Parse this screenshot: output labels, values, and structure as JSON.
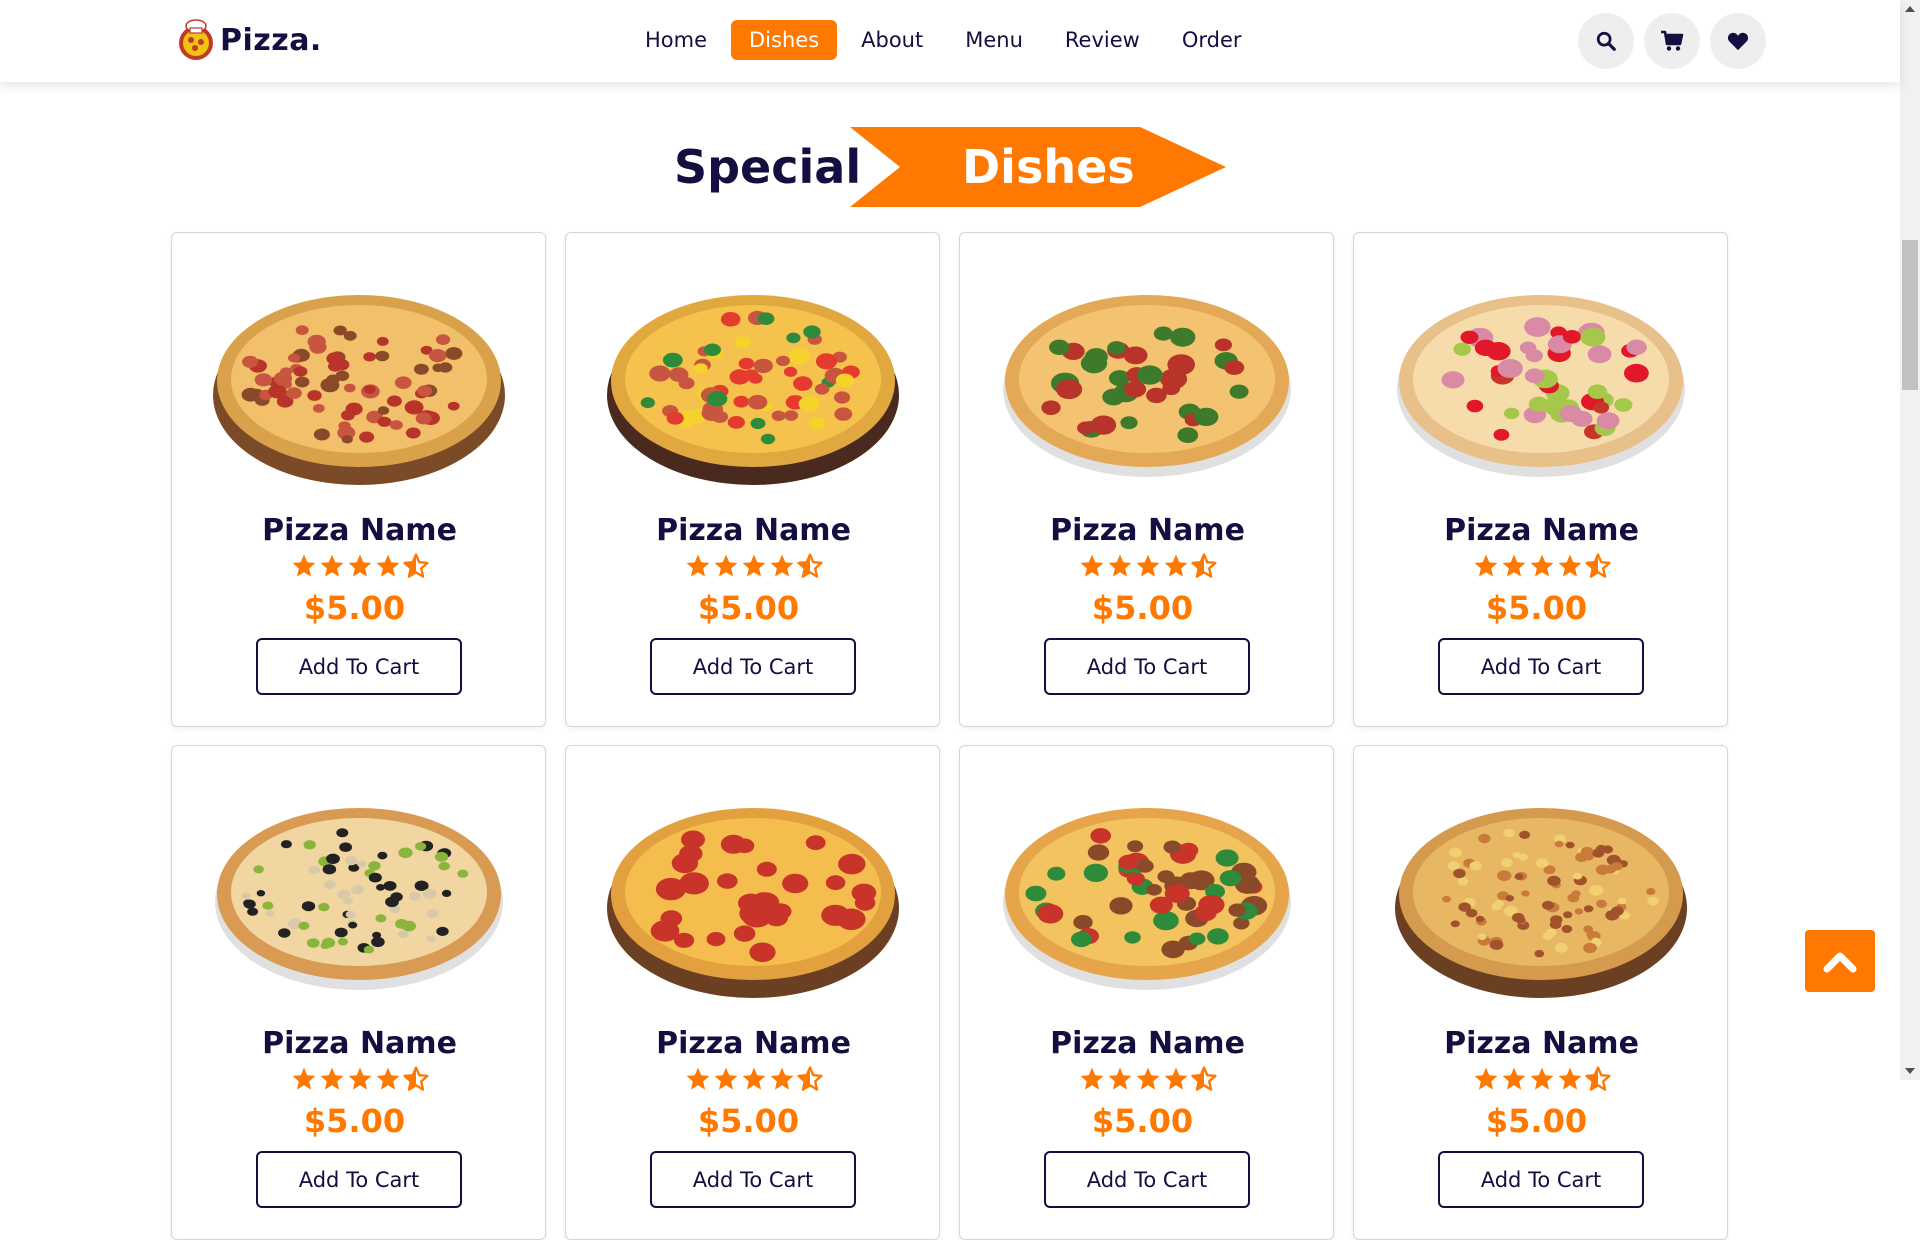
{
  "header": {
    "logo_text": "Pizza.",
    "nav": [
      {
        "label": "Home",
        "active": false
      },
      {
        "label": "Dishes",
        "active": true
      },
      {
        "label": "About",
        "active": false
      },
      {
        "label": "Menu",
        "active": false
      },
      {
        "label": "Review",
        "active": false
      },
      {
        "label": "Order",
        "active": false
      }
    ],
    "icons": [
      "search-icon",
      "cart-icon",
      "heart-icon"
    ]
  },
  "section": {
    "heading_part1": "Special",
    "heading_part2": "Dishes"
  },
  "products": [
    {
      "name": "Pizza Name",
      "rating": 4.5,
      "price": "$5.00",
      "button": "Add To Cart",
      "style": "meat-lovers"
    },
    {
      "name": "Pizza Name",
      "rating": 4.5,
      "price": "$5.00",
      "button": "Add To Cart",
      "style": "veggie-peppers"
    },
    {
      "name": "Pizza Name",
      "rating": 4.5,
      "price": "$5.00",
      "button": "Add To Cart",
      "style": "pepperoni-herbs"
    },
    {
      "name": "Pizza Name",
      "rating": 4.5,
      "price": "$5.00",
      "button": "Add To Cart",
      "style": "spicy-onion"
    },
    {
      "name": "Pizza Name",
      "rating": 4.5,
      "price": "$5.00",
      "button": "Add To Cart",
      "style": "olive-mushroom"
    },
    {
      "name": "Pizza Name",
      "rating": 4.5,
      "price": "$5.00",
      "button": "Add To Cart",
      "style": "classic-pepperoni"
    },
    {
      "name": "Pizza Name",
      "rating": 4.5,
      "price": "$5.00",
      "button": "Add To Cart",
      "style": "deep-pan-slice"
    },
    {
      "name": "Pizza Name",
      "rating": 4.5,
      "price": "$5.00",
      "button": "Add To Cart",
      "style": "sausage-cheese"
    }
  ],
  "colors": {
    "accent": "#ff7800",
    "text": "#130f40",
    "icon_bg": "#eeeeee"
  },
  "back_to_top_icon": "chevron-up-icon"
}
